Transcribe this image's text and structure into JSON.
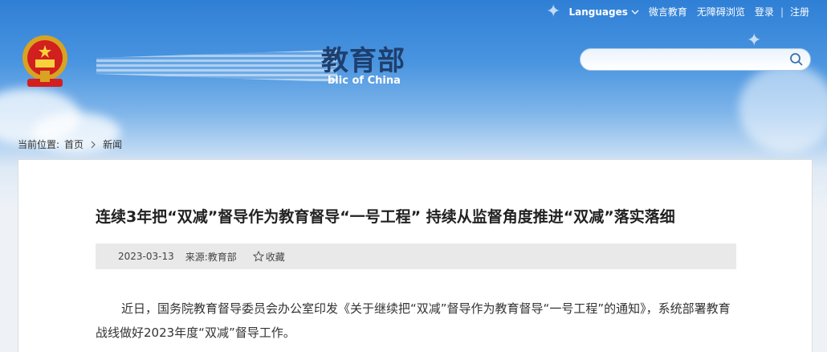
{
  "topbar": {
    "languages": "Languages",
    "weibo": "微言教育",
    "accessible": "无障碍浏览",
    "login": "登录",
    "sep": "|",
    "register": "注册"
  },
  "header": {
    "logo_text": "教育部",
    "logo_sub": "blic of China"
  },
  "search": {
    "value": ""
  },
  "breadcrumb": {
    "prefix": "当前位置:",
    "home": "首页",
    "current": "新闻"
  },
  "article": {
    "title": "连续3年把“双减”督导作为教育督导“一号工程” 持续从监督角度推进“双减”落实落细",
    "date": "2023-03-13",
    "source": "来源:教育部",
    "favorite": "收藏",
    "paragraph": "近日，国务院教育督导委员会办公室印发《关于继续把“双减”督导作为教育督导“一号工程”的通知》，系统部署教育战线做好2023年度“双减”督导工作。"
  }
}
